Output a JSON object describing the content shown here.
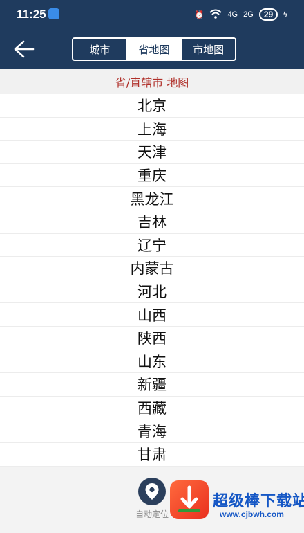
{
  "status": {
    "time": "11:25",
    "net1": "4G",
    "net2": "2G",
    "battery": "29"
  },
  "tabs": [
    {
      "label": "城市",
      "active": false
    },
    {
      "label": "省地图",
      "active": true
    },
    {
      "label": "市地图",
      "active": false
    }
  ],
  "section_title": "省/直辖市 地图",
  "provinces": [
    "北京",
    "上海",
    "天津",
    "重庆",
    "黑龙江",
    "吉林",
    "辽宁",
    "内蒙古",
    "河北",
    "山西",
    "陕西",
    "山东",
    "新疆",
    "西藏",
    "青海",
    "甘肃"
  ],
  "bottom": {
    "locate_label": "自动定位"
  },
  "watermark": {
    "title": "超级棒下载站",
    "url": "www.cjbwh.com"
  },
  "colors": {
    "header_bg": "#1f3b5e",
    "accent_text": "#b0302a"
  }
}
